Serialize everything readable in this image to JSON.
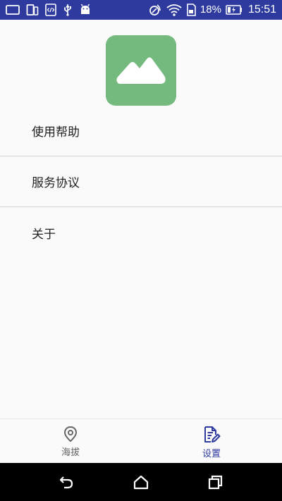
{
  "status_bar": {
    "battery_percent": "18%",
    "time": "15:51"
  },
  "menu": {
    "items": [
      {
        "label": "使用帮助"
      },
      {
        "label": "服务协议"
      },
      {
        "label": "关于"
      }
    ]
  },
  "tabs": {
    "items": [
      {
        "label": "海拔",
        "icon": "location-pin-icon",
        "active": false
      },
      {
        "label": "设置",
        "icon": "settings-document-icon",
        "active": true
      }
    ]
  },
  "colors": {
    "status_bar": "#2e3a9e",
    "logo_background": "#74b97d",
    "active_tab": "#2e3a9e",
    "inactive_tab": "#666666"
  }
}
